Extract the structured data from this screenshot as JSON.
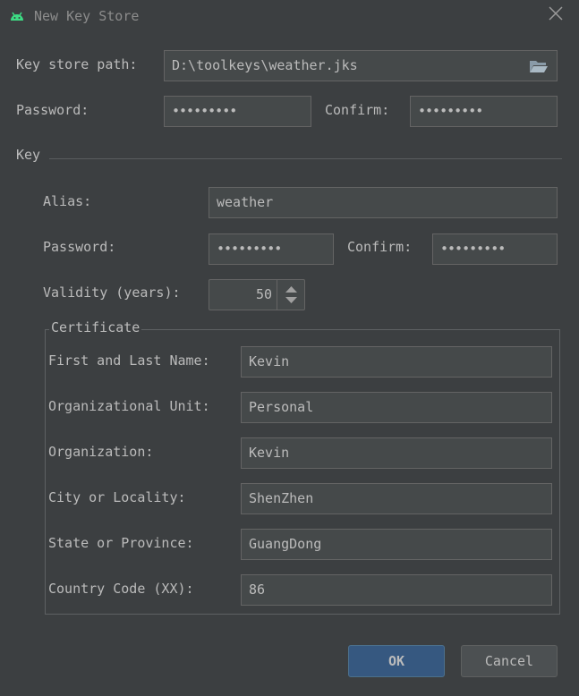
{
  "window": {
    "title": "New Key Store",
    "icon": "android-icon",
    "close_icon": "close-icon"
  },
  "keystore": {
    "path_label": "Key store path:",
    "path_value": "D:\\toolkeys\\weather.jks",
    "folder_icon": "folder-icon",
    "password_label": "Password:",
    "password_value": "•••••••••",
    "confirm_label": "Confirm:",
    "confirm_value": "•••••••••"
  },
  "key": {
    "section_label": "Key",
    "alias_label": "Alias:",
    "alias_value": "weather",
    "password_label": "Password:",
    "password_value": "•••••••••",
    "confirm_label": "Confirm:",
    "confirm_value": "•••••••••",
    "validity_label": "Validity (years):",
    "validity_value": "50"
  },
  "certificate": {
    "legend": "Certificate",
    "fields": [
      {
        "label": "First and Last Name:",
        "value": "Kevin"
      },
      {
        "label": "Organizational Unit:",
        "value": "Personal"
      },
      {
        "label": "Organization:",
        "value": "Kevin"
      },
      {
        "label": "City or Locality:",
        "value": "ShenZhen"
      },
      {
        "label": "State or Province:",
        "value": "GuangDong"
      },
      {
        "label": "Country Code (XX):",
        "value": "86"
      }
    ]
  },
  "buttons": {
    "ok": "OK",
    "cancel": "Cancel"
  },
  "colors": {
    "background": "#3c3f41",
    "field": "#45494a",
    "accent": "#365880",
    "android_green": "#3ddc84"
  }
}
